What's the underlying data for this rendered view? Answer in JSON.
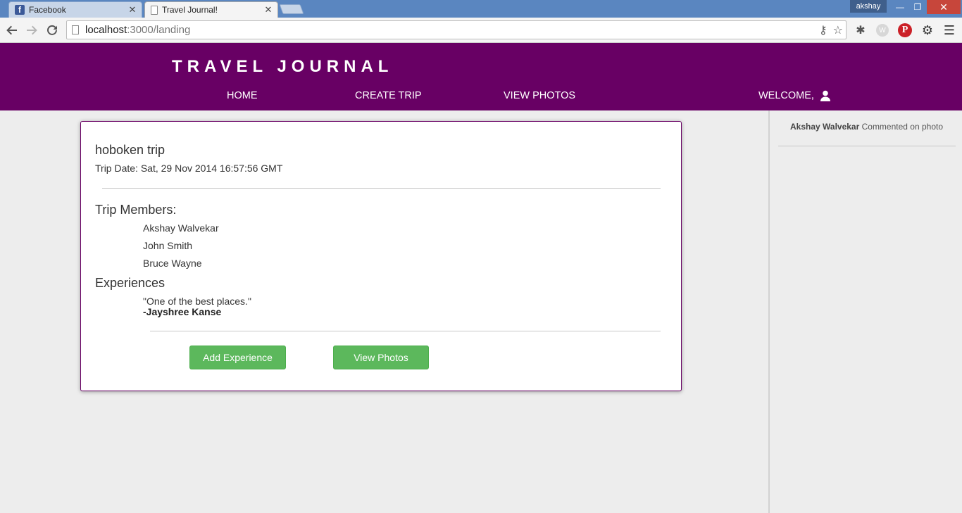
{
  "browser": {
    "tabs": [
      {
        "title": "Facebook",
        "active": false
      },
      {
        "title": "Travel Journal!",
        "active": true
      }
    ],
    "profile_name": "akshay",
    "url_host": "localhost",
    "url_path": ":3000/landing"
  },
  "header": {
    "brand": "TRAVEL JOURNAL",
    "nav": {
      "home": "HOME",
      "create_trip": "CREATE TRIP",
      "view_photos": "VIEW PHOTOS",
      "welcome": "WELCOME,"
    }
  },
  "trip": {
    "name": "hoboken trip",
    "date": "Trip Date: Sat, 29 Nov 2014 16:57:56 GMT",
    "members_heading": "Trip Members:",
    "members": [
      "Akshay Walvekar",
      "John Smith",
      "Bruce Wayne"
    ],
    "experiences_heading": "Experiences",
    "experiences": [
      {
        "quote": "\"One of the best places.\"",
        "author": "-Jayshree Kanse"
      }
    ],
    "add_experience_label": "Add Experience",
    "view_photos_label": "View Photos"
  },
  "sidebar": {
    "activity_user": "Akshay Walvekar",
    "activity_text": " Commented on photo"
  },
  "colors": {
    "header_bg": "#680064",
    "button_green": "#5cb85c"
  }
}
